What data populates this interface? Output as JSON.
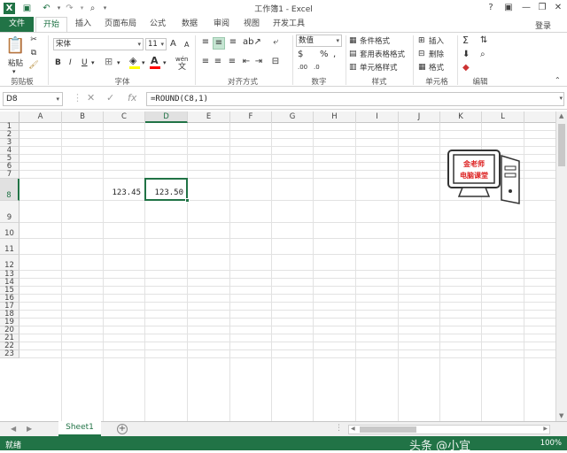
{
  "window": {
    "title": "工作簿1 - Excel",
    "minimize": "—",
    "restore": "❐",
    "close": "✕",
    "help": "?"
  },
  "qat": {
    "save_icon": "save-icon",
    "undo_icon": "undo-icon",
    "redo_icon": "redo-icon",
    "preview_icon": "print-preview-icon"
  },
  "tabs": [
    "文件",
    "开始",
    "插入",
    "页面布局",
    "公式",
    "数据",
    "审阅",
    "视图",
    "开发工具"
  ],
  "login": "登录",
  "ribbon": {
    "clipboard": {
      "paste": "粘贴",
      "label": "剪贴板"
    },
    "font": {
      "name": "宋体",
      "size": "11",
      "bold": "B",
      "italic": "I",
      "underline": "U",
      "label": "字体",
      "grow": "A",
      "shrink": "A",
      "wen": "wén",
      "fill_color": "#ffff00",
      "font_color": "#ff0000"
    },
    "alignment": {
      "label": "对齐方式"
    },
    "number": {
      "format": "数值",
      "label": "数字"
    },
    "styles": {
      "conditional": "条件格式",
      "table": "套用表格格式",
      "cell_styles": "单元格样式",
      "label": "样式"
    },
    "cells": {
      "insert": "插入",
      "delete": "删除",
      "format": "格式",
      "label": "单元格"
    },
    "editing": {
      "label": "编辑"
    }
  },
  "formula_bar": {
    "name_box": "D8",
    "fx": "fx",
    "formula": "=ROUND(C8,1)"
  },
  "columns": [
    "A",
    "B",
    "C",
    "D",
    "E",
    "F",
    "G",
    "H",
    "I",
    "J",
    "K",
    "L"
  ],
  "rows": [
    "1",
    "2",
    "3",
    "4",
    "5",
    "6",
    "7",
    "8",
    "9",
    "10",
    "11",
    "12",
    "13",
    "14",
    "15",
    "16",
    "17",
    "18",
    "19",
    "20",
    "21",
    "22",
    "23"
  ],
  "cells": {
    "C8": "123.45",
    "D8": "123.50"
  },
  "selected": {
    "column": "D",
    "row": "8"
  },
  "sheets": [
    "Sheet1"
  ],
  "status": {
    "ready": "就绪",
    "watermark": "头条 @小宜",
    "zoom": "100%"
  },
  "logo": {
    "line1": "金老师",
    "line2": "电脑课堂"
  },
  "colors": {
    "excel_green": "#217346"
  }
}
